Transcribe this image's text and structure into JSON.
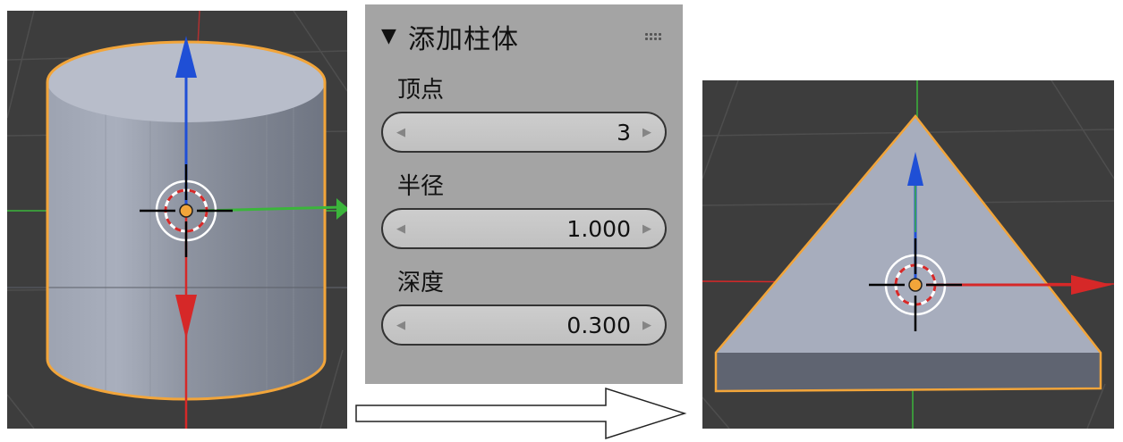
{
  "panel": {
    "title": "添加柱体",
    "collapse_icon": "▼",
    "fields": [
      {
        "label": "顶点",
        "value": "3"
      },
      {
        "label": "半径",
        "value": "1.000"
      },
      {
        "label": "深度",
        "value": "0.300"
      }
    ]
  },
  "colors": {
    "viewport_bg": "#3d3d3d",
    "panel_bg": "#a4a4a4",
    "selection_outline": "#f2a53a",
    "axis_x": "#d62828",
    "axis_y": "#3bb53b",
    "axis_z": "#1f4fd6",
    "mesh_gray": "#a7adbd"
  },
  "icons": [
    "collapse-triangle-icon",
    "grip-icon",
    "decrement-arrow-icon",
    "increment-arrow-icon",
    "3d-cursor-icon",
    "flow-arrow-icon"
  ]
}
